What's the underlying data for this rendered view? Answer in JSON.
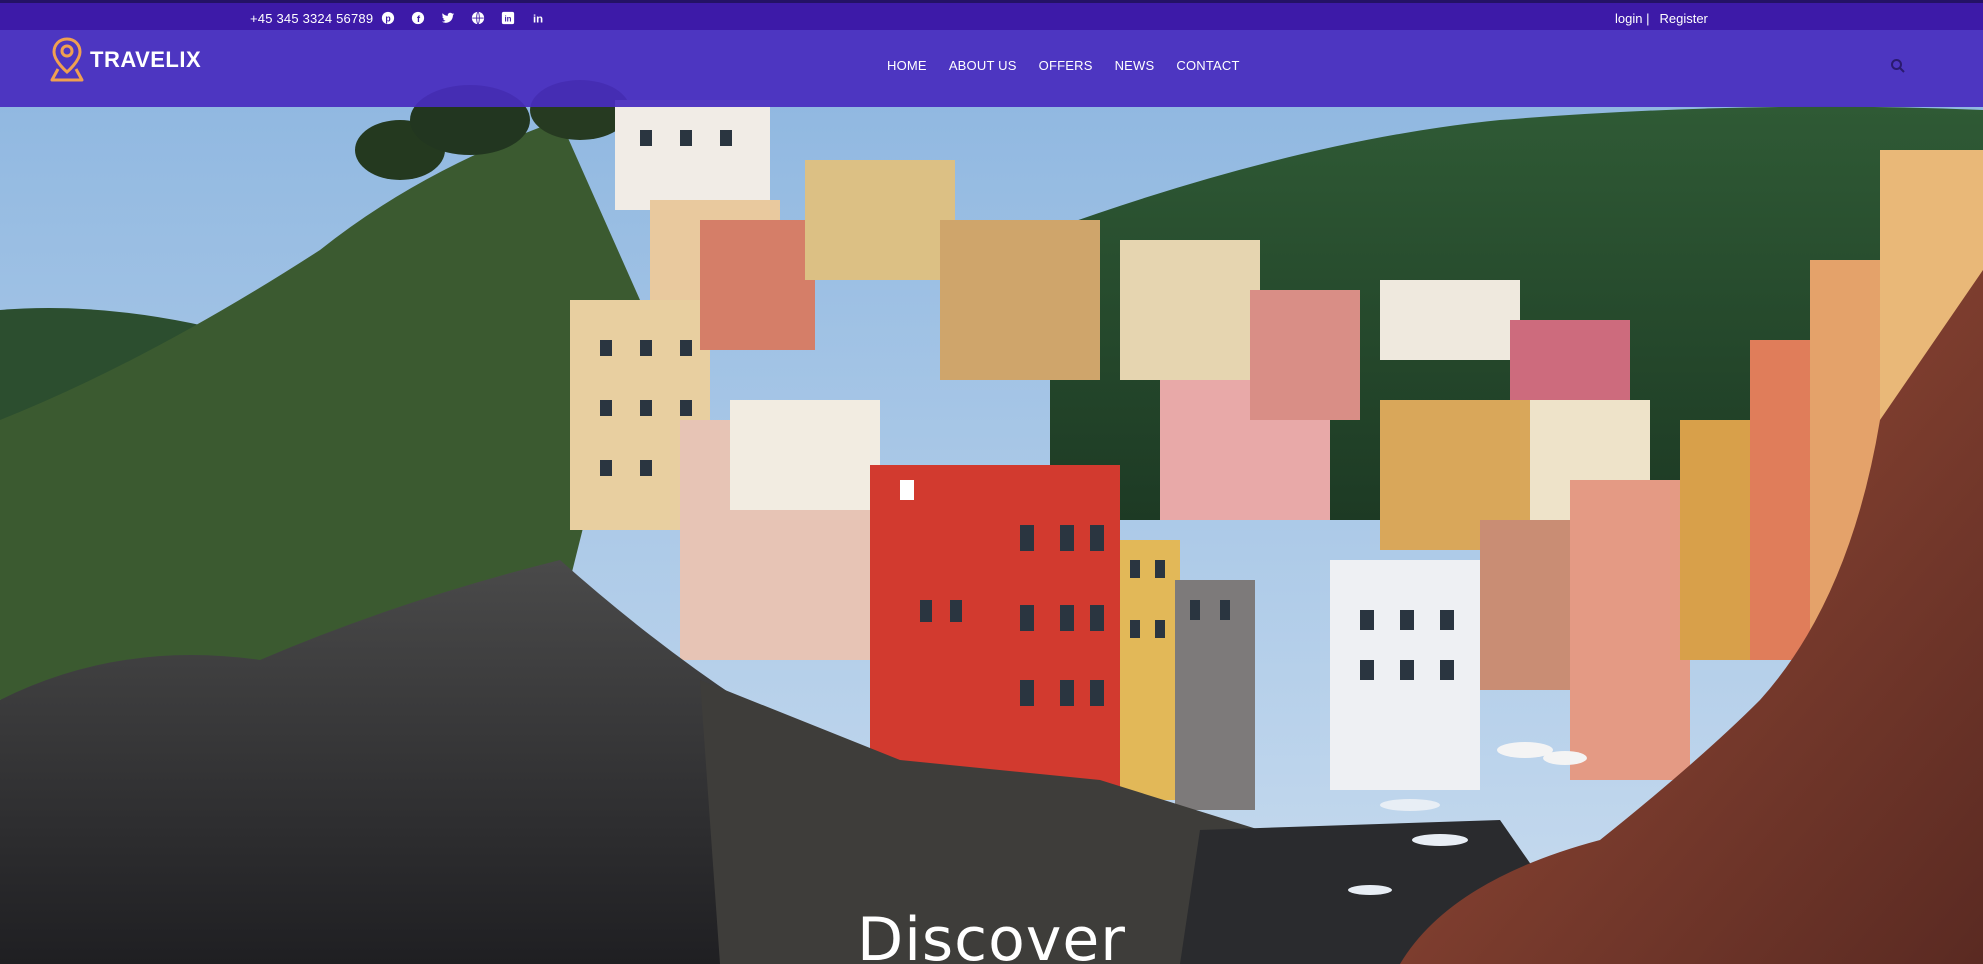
{
  "top_bar": {
    "phone": "+45 345 3324 56789",
    "socials": [
      "pinterest-icon",
      "facebook-icon",
      "twitter-icon",
      "globe-icon",
      "linkedin-square-icon",
      "linkedin-icon"
    ],
    "login": "login |",
    "register": "Register"
  },
  "nav": {
    "logo_text": "TRAVELIX",
    "items": [
      "HOME",
      "ABOUT US",
      "OFFERS",
      "NEWS",
      "CONTACT"
    ],
    "search_icon": "search-icon"
  },
  "hero": {
    "title": "Discover",
    "background": "coastal-village-photo"
  },
  "colors": {
    "top_bar": "#3d1aa8",
    "nav": "#482cbe",
    "logo_accent": "#f0a050",
    "text": "#ffffff"
  }
}
